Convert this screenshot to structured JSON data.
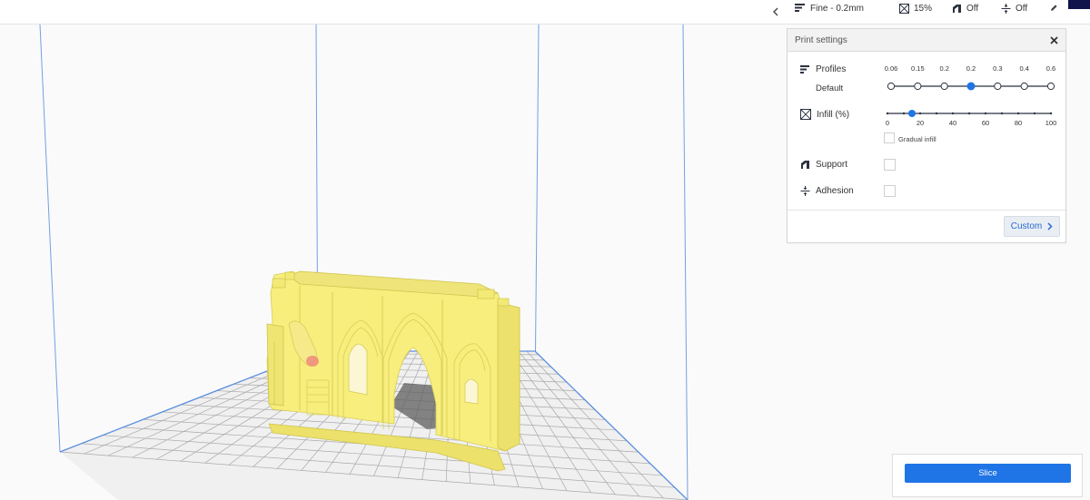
{
  "header": {
    "collapse_icon": "chevron-left-icon",
    "profile_summary": "Fine - 0.2mm",
    "infill_summary": "15%",
    "support_summary": "Off",
    "adhesion_summary": "Off",
    "edit_icon": "pencil-icon"
  },
  "print_settings": {
    "title": "Print settings",
    "close_icon": "close-icon",
    "profiles": {
      "label": "Profiles",
      "selected_name": "Default",
      "layer_heights": [
        "0.06",
        "0.15",
        "0.2",
        "0.2",
        "0.3",
        "0.4",
        "0.6"
      ],
      "selected_index": 3
    },
    "infill": {
      "label": "Infill (%)",
      "ticks": [
        "0",
        "20",
        "40",
        "60",
        "80",
        "100"
      ],
      "value_percent": 15,
      "gradual_label": "Gradual infill",
      "gradual_checked": false
    },
    "support": {
      "label": "Support",
      "checked": false
    },
    "adhesion": {
      "label": "Adhesion",
      "checked": false
    },
    "custom_button": "Custom"
  },
  "slice": {
    "button_label": "Slice"
  },
  "colors": {
    "accent": "#1f74e6",
    "model": "#f6ec7a",
    "build_volume_lines": "#5b8fe0",
    "grid_lines": "#a9a9a9"
  }
}
